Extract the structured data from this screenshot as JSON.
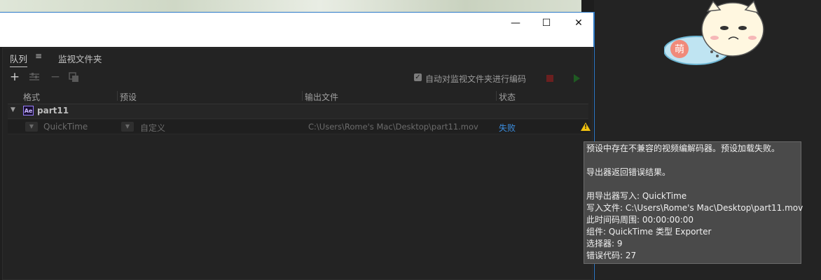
{
  "window": {
    "controls": {
      "minimize": "—",
      "maximize": "☐",
      "close": "✕"
    }
  },
  "panel": {
    "tabs": [
      {
        "label": "队列",
        "active": true
      },
      {
        "label": "监视文件夹",
        "active": false
      }
    ],
    "tab_menu_icon": "hamburger-icon",
    "toolbar": {
      "add": "+",
      "add_icon": "plus-icon",
      "settings_icon": "sliders-icon",
      "remove": "−",
      "remove_icon": "minus-icon",
      "duplicate_icon": "duplicate-icon"
    },
    "auto_encode": {
      "checked": true,
      "label": "自动对监视文件夹进行编码"
    },
    "stop_color": "#6b1f1f",
    "play_color": "#1f5a22"
  },
  "table": {
    "columns": [
      "格式",
      "预设",
      "输出文件",
      "状态"
    ],
    "group": {
      "name": "part11",
      "app_badge": "Ae"
    },
    "rows": [
      {
        "format": "QuickTime",
        "preset": "自定义",
        "output": "C:\\Users\\Rome's Mac\\Desktop\\part11.mov",
        "status": "失败",
        "status_color": "#3c8ee0",
        "warning_icon": "warning-icon"
      }
    ]
  },
  "tooltip": {
    "lines": [
      "预设中存在不兼容的视频编解码器。预设加载失败。",
      "",
      "导出器返回错误结果。",
      "",
      "用导出器写入: QuickTime",
      "写入文件: C:\\Users\\Rome's Mac\\Desktop\\part11.mov",
      "此时间码周围: 00:00:00:00",
      "组件: QuickTime 类型 Exporter",
      "选择器: 9",
      "错误代码: 27"
    ]
  },
  "sticker": {
    "text": "萌"
  }
}
